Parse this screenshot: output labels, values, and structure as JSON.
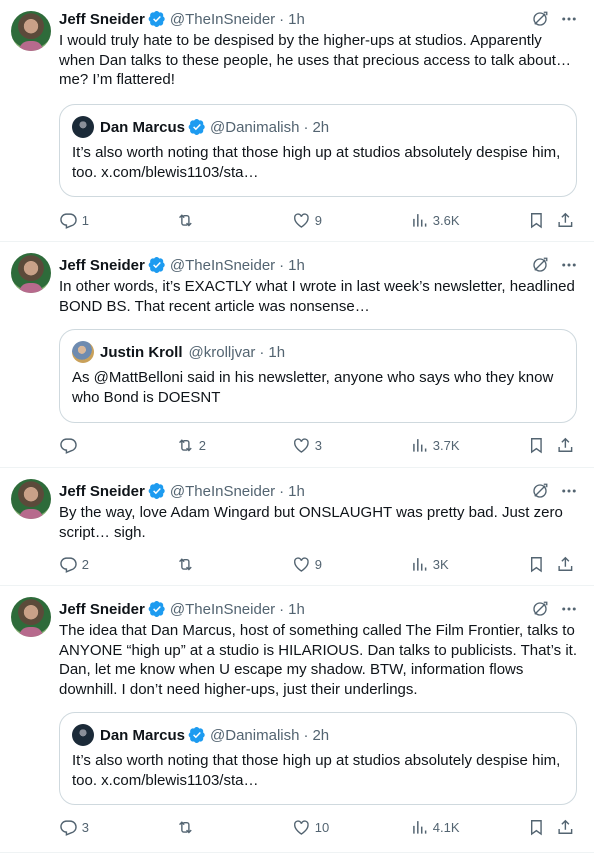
{
  "tweets": [
    {
      "author": {
        "name": "Jeff Sneider",
        "handle": "@TheInSneider"
      },
      "time": "1h",
      "text": "I would truly hate to be despised by the higher-ups at studios. Apparently when Dan talks to these people, he uses that precious access to talk about… me? I’m flattered!",
      "quote": {
        "name": "Dan Marcus",
        "handle": "@Danimalish",
        "time": "2h",
        "verified": true,
        "text": "It’s also worth noting that those high up at studios absolutely despise him, too. x.com/blewis1103/sta…"
      },
      "stats": {
        "replies": "1",
        "retweets": "",
        "likes": "9",
        "views": "3.6K"
      }
    },
    {
      "author": {
        "name": "Jeff Sneider",
        "handle": "@TheInSneider"
      },
      "time": "1h",
      "text": "In other words, it’s EXACTLY what I wrote in last week’s newsletter, headlined BOND BS. That recent article was nonsense…",
      "quote": {
        "name": "Justin Kroll",
        "handle": "@krolljvar",
        "time": "1h",
        "verified": false,
        "text": "As @MattBelloni said in his newsletter, anyone who says who they know who Bond is DOESNT"
      },
      "stats": {
        "replies": "",
        "retweets": "2",
        "likes": "3",
        "views": "3.7K"
      }
    },
    {
      "author": {
        "name": "Jeff Sneider",
        "handle": "@TheInSneider"
      },
      "time": "1h",
      "text": "By the way, love Adam Wingard but ONSLAUGHT was pretty bad. Just zero script… sigh.",
      "quote": null,
      "stats": {
        "replies": "2",
        "retweets": "",
        "likes": "9",
        "views": "3K"
      }
    },
    {
      "author": {
        "name": "Jeff Sneider",
        "handle": "@TheInSneider"
      },
      "time": "1h",
      "text": "The idea that Dan Marcus, host of something called The Film Frontier, talks to ANYONE “high up” at a studio is HILARIOUS. Dan talks to publicists. That’s it. Dan, let me know when U escape my shadow. BTW, information flows downhill. I don’t need higher-ups, just their underlings.",
      "quote": {
        "name": "Dan Marcus",
        "handle": "@Danimalish",
        "time": "2h",
        "verified": true,
        "text": "It’s also worth noting that those high up at studios absolutely despise him, too. x.com/blewis1103/sta…"
      },
      "stats": {
        "replies": "3",
        "retweets": "",
        "likes": "10",
        "views": "4.1K"
      }
    }
  ],
  "separator": "·",
  "icons": {
    "verified": "verified-badge-icon",
    "grok": "grok-icon",
    "more": "more-icon",
    "reply": "reply-icon",
    "retweet": "retweet-icon",
    "like": "like-icon",
    "views": "views-icon",
    "bookmark": "bookmark-icon",
    "share": "share-icon"
  },
  "colors": {
    "text": "#0f1419",
    "secondary": "#536471",
    "verified": "#1d9bf0",
    "border": "#cfd9de",
    "divider": "#eff3f4"
  }
}
